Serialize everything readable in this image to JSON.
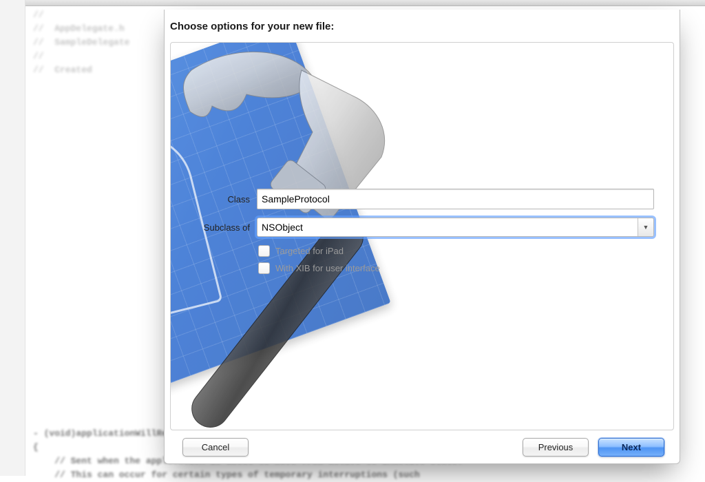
{
  "dialog": {
    "title": "Choose options for your new file:",
    "fields": {
      "class_label": "Class",
      "class_value": "SampleProtocol",
      "subclass_label": "Subclass of",
      "subclass_value": "NSObject"
    },
    "checkboxes": {
      "targeted_ipad": {
        "label": "Targeted for iPad",
        "checked": false,
        "enabled": false
      },
      "with_xib": {
        "label": "With XIB for user interface",
        "checked": false,
        "enabled": false
      }
    },
    "buttons": {
      "cancel": "Cancel",
      "previous": "Previous",
      "next": "Next"
    }
  },
  "background_code": {
    "top_lines": "//\n//  AppDelegate.h\n//  SampleDelegate\n//\n//  Created",
    "bottom_lines": "- (void)applicationWillResignActive:(UIApplication *)application\n{\n    // Sent when the application is about to move from active to inactive state.\n    // This can occur for certain types of temporary interruptions (such"
  }
}
